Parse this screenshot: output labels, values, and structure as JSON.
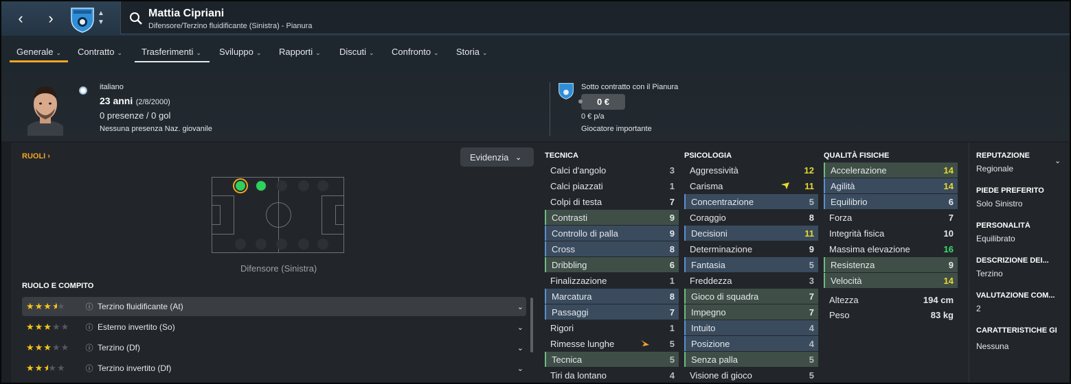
{
  "header": {
    "player_name": "Mattia Cipriani",
    "subtitle": "Difensore/Terzino fluidificante (Sinistra) - Pianura"
  },
  "tabs": [
    {
      "label": "Generale"
    },
    {
      "label": "Contratto"
    },
    {
      "label": "Trasferimenti"
    },
    {
      "label": "Sviluppo"
    },
    {
      "label": "Rapporti"
    },
    {
      "label": "Discuti"
    },
    {
      "label": "Confronto"
    },
    {
      "label": "Storia"
    }
  ],
  "profile": {
    "nationality": "italiano",
    "age": "23 anni",
    "birth": "(2/8/2000)",
    "apps": "0 presenze / 0 gol",
    "youth": "Nessuna presenza Naz. giovanile"
  },
  "contract": {
    "club_line": "Sotto contratto con il Pianura",
    "value": "0 €",
    "wage": "0 € p/a",
    "status": "Giocatore importante"
  },
  "roles": {
    "header": "RUOLI",
    "position": "Difensore (Sinistra)",
    "highlight_btn": "Evidenzia",
    "duty_header": "RUOLO E COMPITO",
    "items": [
      {
        "name": "Terzino fluidificante (At)",
        "stars": 3.5
      },
      {
        "name": "Esterno invertito (So)",
        "stars": 3
      },
      {
        "name": "Terzino (Df)",
        "stars": 3
      },
      {
        "name": "Terzino invertito (Df)",
        "stars": 2.5
      }
    ]
  },
  "technical": {
    "header": "TECNICA",
    "items": [
      {
        "n": "Calci d'angolo",
        "v": "3"
      },
      {
        "n": "Calci piazzati",
        "v": "1"
      },
      {
        "n": "Colpi di testa",
        "v": "7"
      },
      {
        "n": "Contrasti",
        "v": "9"
      },
      {
        "n": "Controllo di palla",
        "v": "9"
      },
      {
        "n": "Cross",
        "v": "8"
      },
      {
        "n": "Dribbling",
        "v": "6"
      },
      {
        "n": "Finalizzazione",
        "v": "1"
      },
      {
        "n": "Marcatura",
        "v": "8"
      },
      {
        "n": "Passaggi",
        "v": "7"
      },
      {
        "n": "Rigori",
        "v": "1"
      },
      {
        "n": "Rimesse lunghe",
        "v": "5"
      },
      {
        "n": "Tecnica",
        "v": "5"
      },
      {
        "n": "Tiri da lontano",
        "v": "4"
      }
    ]
  },
  "mental": {
    "header": "PSICOLOGIA",
    "items": [
      {
        "n": "Aggressività",
        "v": "12"
      },
      {
        "n": "Carisma",
        "v": "11"
      },
      {
        "n": "Concentrazione",
        "v": "5"
      },
      {
        "n": "Coraggio",
        "v": "8"
      },
      {
        "n": "Decisioni",
        "v": "11"
      },
      {
        "n": "Determinazione",
        "v": "9"
      },
      {
        "n": "Fantasia",
        "v": "5"
      },
      {
        "n": "Freddezza",
        "v": "3"
      },
      {
        "n": "Gioco di squadra",
        "v": "7"
      },
      {
        "n": "Impegno",
        "v": "7"
      },
      {
        "n": "Intuito",
        "v": "4"
      },
      {
        "n": "Posizione",
        "v": "4"
      },
      {
        "n": "Senza palla",
        "v": "5"
      },
      {
        "n": "Visione di gioco",
        "v": "5"
      }
    ]
  },
  "physical": {
    "header": "QUALITÀ FISICHE",
    "items": [
      {
        "n": "Accelerazione",
        "v": "14"
      },
      {
        "n": "Agilità",
        "v": "14"
      },
      {
        "n": "Equilibrio",
        "v": "6"
      },
      {
        "n": "Forza",
        "v": "7"
      },
      {
        "n": "Integrità fisica",
        "v": "10"
      },
      {
        "n": "Massima elevazione",
        "v": "16"
      },
      {
        "n": "Resistenza",
        "v": "9"
      },
      {
        "n": "Velocità",
        "v": "14"
      }
    ],
    "height_label": "Altezza",
    "height": "194 cm",
    "weight_label": "Peso",
    "weight": "83 kg"
  },
  "side": [
    {
      "k": "REPUTAZIONE",
      "v": "Regionale"
    },
    {
      "k": "PIEDE PREFERITO",
      "v": "Solo Sinistro"
    },
    {
      "k": "PERSONALITÀ",
      "v": "Equilibrato"
    },
    {
      "k": "DESCRIZIONE DEI...",
      "v": "Terzino"
    },
    {
      "k": "VALUTAZIONE COM...",
      "v": "2"
    },
    {
      "k": "CARATTERISTICHE GI",
      "v": "Nessuna"
    }
  ],
  "colors": {
    "accent": "#f5a623",
    "green_hl": "#3f4f48",
    "blue_hl": "#3a4b5e",
    "yellow_val": "#e8d82f",
    "green_val": "#3ddc68"
  }
}
